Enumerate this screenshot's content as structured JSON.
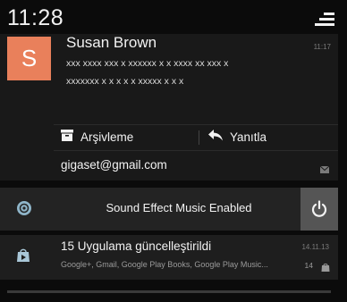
{
  "status_bar": {
    "time": "11:28"
  },
  "email_notification": {
    "avatar_letter": "S",
    "sender": "Susan Brown",
    "time": "11:17",
    "body_line1": "xxx xxxx xxx x xxxxxx x x xxxx xx xxx x",
    "body_line2": "xxxxxxx x x x x x xxxxx x x x",
    "actions": {
      "archive_label": "Arşivleme",
      "reply_label": "Yanıtla"
    },
    "account": "gigaset@gmail.com"
  },
  "sound_notification": {
    "text": "Sound Effect Music Enabled"
  },
  "update_notification": {
    "title": "15 Uygulama güncelleştirildi",
    "subtitle": "Google+, Gmail, Google Play Books, Google Play Music...",
    "time": "14.11.13",
    "count": "14"
  },
  "colors": {
    "avatar_bg": "#e9805b",
    "background": "#0b0b0b",
    "card_bg": "#191919"
  },
  "icons": {
    "menu": "quick-settings-menu-icon",
    "archive": "archive-icon",
    "reply": "reply-icon",
    "mail": "mail-icon",
    "sound_app": "sound-app-icon",
    "power": "power-icon",
    "store": "play-store-icon"
  }
}
